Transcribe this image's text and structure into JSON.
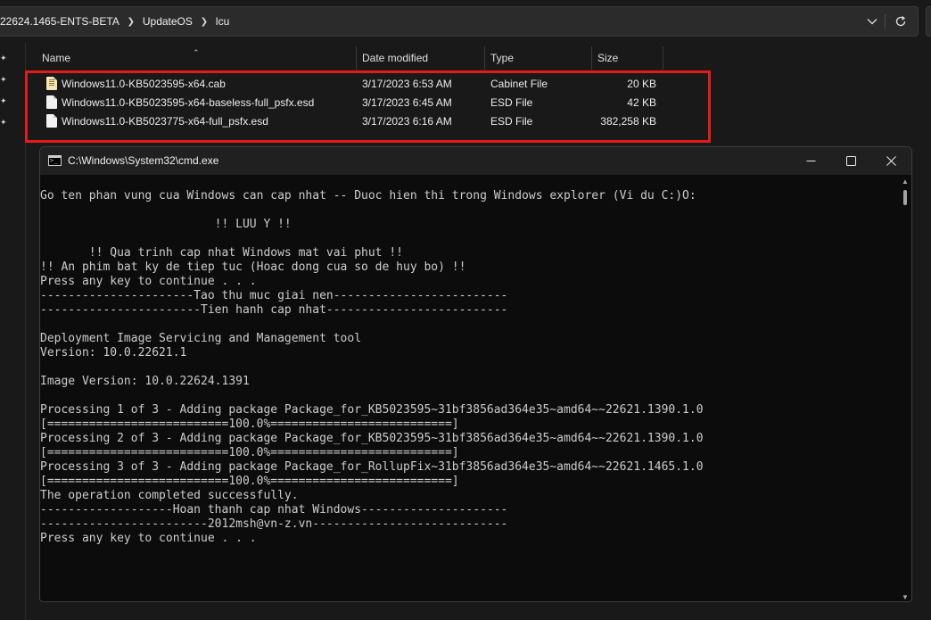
{
  "explorer": {
    "breadcrumbs": [
      "22624.1465-ENTS-BETA",
      "UpdateOS",
      "lcu"
    ],
    "columns": {
      "name": "Name",
      "date": "Date modified",
      "type": "Type",
      "size": "Size"
    },
    "files": [
      {
        "name": "Windows11.0-KB5023595-x64.cab",
        "date": "3/17/2023 6:53 AM",
        "type": "Cabinet File",
        "size": "20 KB",
        "icon": "cabinet-file-icon"
      },
      {
        "name": "Windows11.0-KB5023595-x64-baseless-full_psfx.esd",
        "date": "3/17/2023 6:45 AM",
        "type": "ESD File",
        "size": "42 KB",
        "icon": "esd-file-icon"
      },
      {
        "name": "Windows11.0-KB5023775-x64-full_psfx.esd",
        "date": "3/17/2023 6:16 AM",
        "type": "ESD File",
        "size": "382,258 KB",
        "icon": "esd-file-icon"
      }
    ],
    "highlight_color": "#e21b1b"
  },
  "cmd": {
    "title": "C:\\Windows\\System32\\cmd.exe",
    "lines": [
      "Go ten phan vung cua Windows can cap nhat -- Duoc hien thi trong Windows explorer (Vi du C:)O:",
      "",
      "                         !! LUU Y !!",
      "",
      "       !! Qua trinh cap nhat Windows mat vai phut !!",
      "!! An phim bat ky de tiep tuc (Hoac dong cua so de huy bo) !!",
      "Press any key to continue . . .",
      "----------------------Tao thu muc giai nen-------------------------",
      "-----------------------Tien hanh cap nhat--------------------------",
      "",
      "Deployment Image Servicing and Management tool",
      "Version: 10.0.22621.1",
      "",
      "Image Version: 10.0.22624.1391",
      "",
      "Processing 1 of 3 - Adding package Package_for_KB5023595~31bf3856ad364e35~amd64~~22621.1390.1.0",
      "[==========================100.0%==========================]",
      "Processing 2 of 3 - Adding package Package_for_KB5023595~31bf3856ad364e35~amd64~~22621.1390.1.0",
      "[==========================100.0%==========================]",
      "Processing 3 of 3 - Adding package Package_for_RollupFix~31bf3856ad364e35~amd64~~22621.1465.1.0",
      "[==========================100.0%==========================]",
      "The operation completed successfully.",
      "-------------------Hoan thanh cap nhat Windows---------------------",
      "------------------------2012msh@vn-z.vn----------------------------",
      "Press any key to continue . . ."
    ]
  },
  "colors": {
    "explorer_bg": "#191919",
    "console_bg": "#0c0c0c",
    "console_text": "#cccccc"
  }
}
